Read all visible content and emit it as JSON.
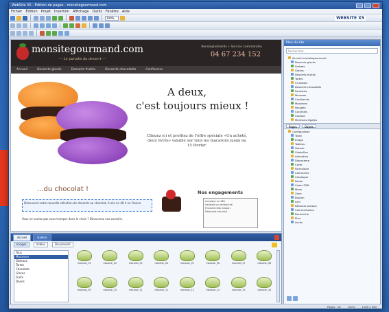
{
  "window": {
    "title": "WebSite X5 - Édition de pages - monsitegourmand.com"
  },
  "menu": [
    "Fichier",
    "Édition",
    "Projet",
    "Insertion",
    "Affichage",
    "Outils",
    "Fenêtre",
    "Aide"
  ],
  "toolbar": {
    "zoom": "100%",
    "brand": "WEBSITE X5"
  },
  "site": {
    "logo": "monsitegourmand.com",
    "tagline": "— Le paradis du dessert —",
    "contact_label": "Renseignements • Service commandes",
    "phone": "04 67 234 152",
    "nav": [
      "Accueil",
      "Desserts glacés",
      "Desserts fruités",
      "Desserts chocolatés",
      "Confiseries"
    ]
  },
  "hero": {
    "title_line1": "A deux,",
    "title_line2": "c'est toujours mieux !",
    "offer": "Cliquez ici et profitez de l'offre spéciale «Un acheté, deux livrés» valable sur tous les macarons jusqu'au 15 février."
  },
  "section": {
    "title": "...du chocolat !",
    "text": "Découvrez notre nouvelle sélection de desserts au chocolat, livrés en 48 h en France.",
    "text2": "Vous ne voulez pas vous tromper dans le choix ? Découvrez nos conseils.",
    "engage_title": "Nos engagements",
    "engage_lines": [
      "Livraison en 48h",
      "Satisfait ou remboursé",
      "Produits faits maison",
      "Paiement sécurisé"
    ]
  },
  "tree_panel": {
    "header": "Plan du site",
    "search_placeholder": "Rechercher...",
    "items": [
      "Accueil monsitegourmand",
      "Desserts glacés",
      "Sorbets",
      "Glaces",
      "Desserts fruités",
      "Tartes",
      "Crumbles",
      "Desserts chocolatés",
      "Fondants",
      "Mousses",
      "Confiseries",
      "Macarons",
      "Nougats",
      "Caramels",
      "Contact",
      "Mentions légales"
    ],
    "tabs": [
      "Pages",
      "Objets"
    ],
    "items2": [
      "Configuration",
      "Texte",
      "Image",
      "Tableau",
      "Galerie",
      "Vidéo/Son",
      "Animation",
      "Diaporama",
      "Carte",
      "Formulaire",
      "Commerce",
      "Catalogue",
      "Panier",
      "Code HTML",
      "Menu",
      "Zone",
      "Bouton",
      "Lien",
      "Réseaux sociaux",
      "Commentaires",
      "Recherche",
      "Plan",
      "Accès"
    ]
  },
  "bottom_panel": {
    "tabs": [
      "Accueil",
      "Galerie"
    ],
    "filters": [
      "Images",
      "Vidéos",
      "Documents"
    ],
    "categories": [
      "Tous",
      "Macarons",
      "Gâteaux",
      "Tartes",
      "Chocolats",
      "Glaces",
      "Fruits",
      "Divers"
    ],
    "thumbs": [
      "macaron_01",
      "macaron_02",
      "macaron_03",
      "macaron_04",
      "macaron_05",
      "macaron_06",
      "macaron_07",
      "macaron_08",
      "macaron_09",
      "macaron_10",
      "macaron_11",
      "macaron_12",
      "macaron_13",
      "macaron_14",
      "macaron_15",
      "macaron_16"
    ]
  },
  "status": {
    "left": "Pages : 16",
    "zoom": "100%",
    "size": "1280 x 960"
  }
}
